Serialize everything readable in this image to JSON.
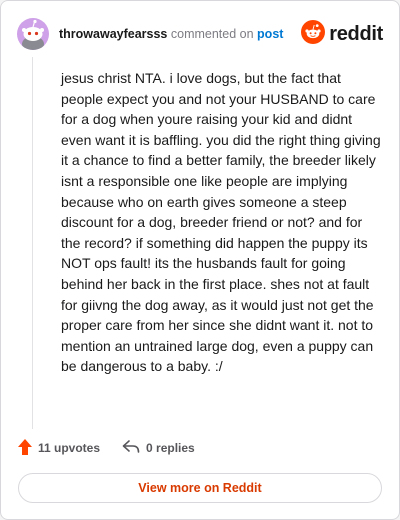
{
  "comment": {
    "username": "throwawayfearsss",
    "action_text": "commented on",
    "post_link": "post",
    "body": "jesus christ NTA. i love dogs, but the fact that people expect you and not your HUSBAND to care for a dog when youre raising your kid and didnt even want it is baffling. you did the right thing giving it a chance to find a better family, the breeder likely isnt a responsible one like people are implying because who on earth gives someone a steep discount for a dog, breeder friend or not? and for the record? if something did happen the puppy its NOT ops fault! its the husbands fault for going behind her back in the first place. shes not at fault for giivng the dog away, as it would just not get the proper care from her since she didnt want it. not to mention an untrained large dog, even a puppy can be dangerous to a baby. :/",
    "upvotes_label": "11 upvotes",
    "replies_label": "0 replies"
  },
  "brand": {
    "wordmark": "reddit",
    "icon": "reddit-logo-icon",
    "accent": "#ff4500"
  },
  "footer": {
    "view_more_label": "View more on Reddit"
  },
  "colors": {
    "link": "#0079d3",
    "view_more_text": "#d93a00",
    "upvote_arrow": "#ff4500",
    "avatar_bg": "#cfa1e8"
  },
  "icons": {
    "avatar": "snoo-avatar-icon",
    "upvote": "upvote-arrow-icon",
    "reply": "reply-arrow-icon"
  }
}
